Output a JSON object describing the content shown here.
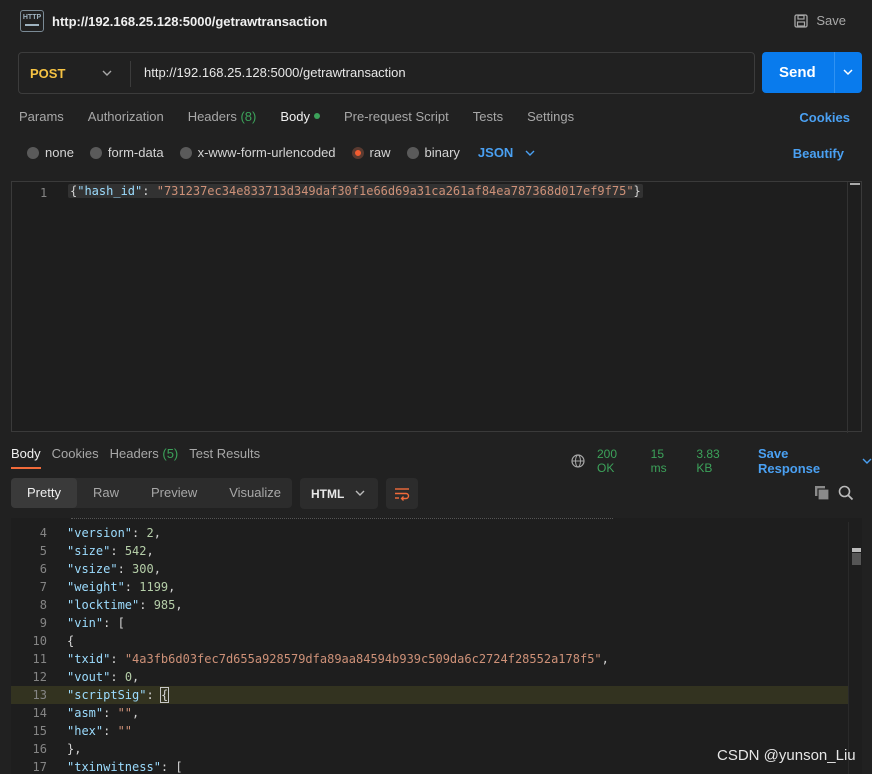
{
  "tab": {
    "title": "http://192.168.25.128:5000/getrawtransaction",
    "icon": "http-icon",
    "save_label": "Save"
  },
  "request": {
    "method": "POST",
    "url": "http://192.168.25.128:5000/getrawtransaction",
    "send_label": "Send"
  },
  "req_tabs": {
    "params": "Params",
    "authorization": "Authorization",
    "headers": "Headers",
    "headers_count": "(8)",
    "body": "Body",
    "prerequest": "Pre-request Script",
    "tests": "Tests",
    "settings": "Settings",
    "cookies": "Cookies"
  },
  "body_options": {
    "none": "none",
    "form_data": "form-data",
    "urlencoded": "x-www-form-urlencoded",
    "raw": "raw",
    "binary": "binary",
    "format": "JSON",
    "beautify": "Beautify",
    "selected": "raw"
  },
  "request_body": {
    "line_no": "1",
    "key": "\"hash_id\"",
    "value": "\"731237ec34e833713d349daf30f1e66d69a31ca261af84ea787368d017ef9f75\""
  },
  "response": {
    "tabs": {
      "body": "Body",
      "cookies": "Cookies",
      "headers": "Headers",
      "headers_count": "(5)",
      "test_results": "Test Results"
    },
    "status": "200 OK",
    "time": "15 ms",
    "size": "3.83 KB",
    "save_response": "Save Response",
    "views": {
      "pretty": "Pretty",
      "raw": "Raw",
      "preview": "Preview",
      "visualize": "Visualize"
    },
    "format": "HTML",
    "lines": [
      {
        "n": "4",
        "key": "\"version\"",
        "val": "2",
        "type": "num",
        "tail": ","
      },
      {
        "n": "5",
        "key": "\"size\"",
        "val": "542",
        "type": "num",
        "tail": ","
      },
      {
        "n": "6",
        "key": "\"vsize\"",
        "val": "300",
        "type": "num",
        "tail": ","
      },
      {
        "n": "7",
        "key": "\"weight\"",
        "val": "1199",
        "type": "num",
        "tail": ","
      },
      {
        "n": "8",
        "key": "\"locktime\"",
        "val": "985",
        "type": "num",
        "tail": ","
      },
      {
        "n": "9",
        "key": "\"vin\"",
        "val": "[",
        "type": "pun",
        "tail": ""
      },
      {
        "n": "10",
        "key": "",
        "val": "{",
        "type": "pun",
        "tail": ""
      },
      {
        "n": "11",
        "key": "\"txid\"",
        "val": "\"4a3fb6d03fec7d655a928579dfa89aa84594b939c509da6c2724f28552a178f5\"",
        "type": "str",
        "tail": ","
      },
      {
        "n": "12",
        "key": "\"vout\"",
        "val": "0",
        "type": "num",
        "tail": ","
      },
      {
        "n": "13",
        "key": "\"scriptSig\"",
        "val": "{",
        "type": "pun",
        "tail": ""
      },
      {
        "n": "14",
        "key": "\"asm\"",
        "val": "\"\"",
        "type": "str",
        "tail": ","
      },
      {
        "n": "15",
        "key": "\"hex\"",
        "val": "\"\"",
        "type": "str",
        "tail": ""
      },
      {
        "n": "16",
        "key": "",
        "val": "}",
        "type": "pun",
        "tail": ","
      },
      {
        "n": "17",
        "key": "\"txinwitness\"",
        "val": "[",
        "type": "pun",
        "tail": ""
      }
    ],
    "highlighted_line": "13"
  },
  "watermark": "CSDN @yunson_Liu"
}
